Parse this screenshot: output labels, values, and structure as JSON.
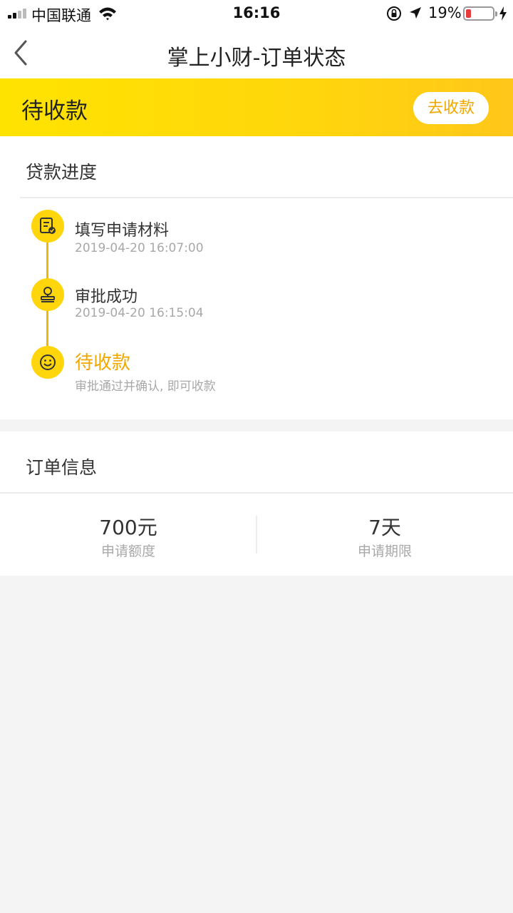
{
  "status_bar": {
    "carrier": "中国联通",
    "time": "16:16",
    "battery_percent": "19%",
    "battery_level": 0.19,
    "battery_color": "#e63c3c"
  },
  "nav": {
    "title": "掌上小财-订单状态",
    "back_icon": "chevron-left-icon"
  },
  "banner": {
    "status": "待收款",
    "action_label": "去收款",
    "accent": "#f0a800",
    "gradient": [
      "#ffe300",
      "#ffc71a"
    ]
  },
  "progress": {
    "title": "贷款进度",
    "steps": [
      {
        "icon": "document-check-icon",
        "title": "填写申请材料",
        "detail": "2019-04-20 16:07:00"
      },
      {
        "icon": "stamp-icon",
        "title": "审批成功",
        "detail": "2019-04-20 16:15:04"
      },
      {
        "icon": "smile-icon",
        "title": "待收款",
        "detail": "审批通过并确认, 即可收款"
      }
    ]
  },
  "order": {
    "title": "订单信息",
    "stats": [
      {
        "value": "700元",
        "label": "申请额度"
      },
      {
        "value": "7天",
        "label": "申请期限"
      }
    ]
  }
}
